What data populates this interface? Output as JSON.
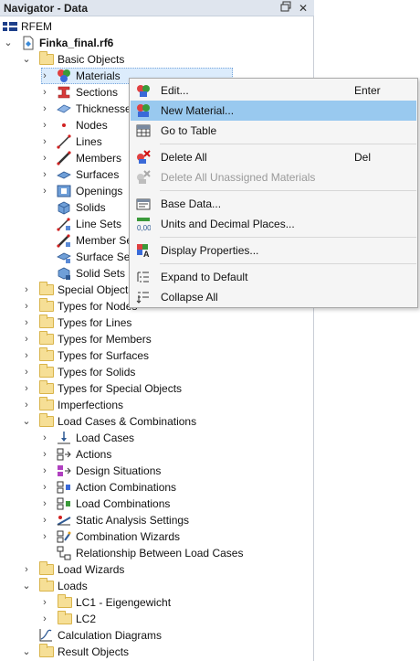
{
  "panel": {
    "title": "Navigator - Data",
    "restore_icon": "restore-window-icon",
    "close_icon": "close-icon"
  },
  "tree": {
    "root": "RFEM",
    "file": "Finka_final.rf6",
    "basic_objects": "Basic Objects",
    "basic_items": [
      "Materials",
      "Sections",
      "Thicknesses",
      "Nodes",
      "Lines",
      "Members",
      "Surfaces",
      "Openings",
      "Solids",
      "Line Sets",
      "Member Sets",
      "Surface Sets",
      "Solid Sets"
    ],
    "folders_a": [
      "Special Objects",
      "Types for Nodes",
      "Types for Lines",
      "Types for Members",
      "Types for Surfaces",
      "Types for Solids",
      "Types for Special Objects",
      "Imperfections"
    ],
    "load_cases": "Load Cases & Combinations",
    "lc_items": [
      "Load Cases",
      "Actions",
      "Design Situations",
      "Action Combinations",
      "Load Combinations",
      "Static Analysis Settings",
      "Combination Wizards",
      "Relationship Between Load Cases"
    ],
    "load_wizards": "Load Wizards",
    "loads": "Loads",
    "loads_items": [
      "LC1 - Eigengewicht",
      "LC2"
    ],
    "calc_diagrams": "Calculation Diagrams",
    "result_objects": "Result Objects"
  },
  "context_menu": {
    "edit": "Edit...",
    "edit_shortcut": "Enter",
    "new_material": "New Material...",
    "go_to_table": "Go to Table",
    "delete_all": "Delete All",
    "delete_shortcut": "Del",
    "delete_unassigned": "Delete All Unassigned Materials",
    "base_data": "Base Data...",
    "units": "Units and Decimal Places...",
    "display_props": "Display Properties...",
    "expand_default": "Expand to Default",
    "collapse_all": "Collapse All"
  },
  "colors": {
    "highlight": "#99c9ef",
    "selection": "#dcecfc",
    "folder": "#f6df96"
  }
}
